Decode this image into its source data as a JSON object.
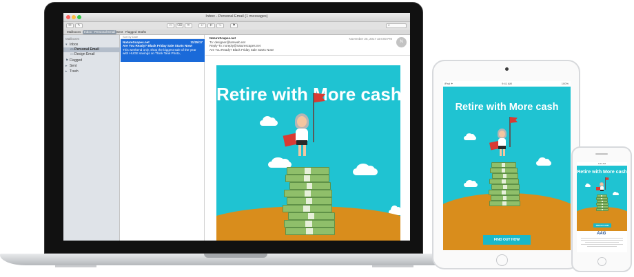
{
  "mail": {
    "window_title": "Inbox - Personal Email (1 messages)",
    "favorites": [
      "Mailboxes",
      "Inbox - Personal Email",
      "Sent",
      "Flagged",
      "Drafts"
    ],
    "sidebar": {
      "heading": "Mailboxes",
      "items": [
        "Inbox",
        "Personal Email",
        "Design Email",
        "Flagged",
        "Sent",
        "Trash"
      ]
    },
    "list": {
      "sort_label": "Sort by Date",
      "message": {
        "sender": "NatureScapes.net",
        "date": "11/25/17",
        "subject": "Are You Ready? Black Friday Sale Starts Now!",
        "preview": "This weekend only, shop the biggest sale of the year with HUGE savings on Think Tank Photo,"
      }
    },
    "reader": {
      "from": "NatureScapes.net",
      "to": "To:  designer@lamweb.net",
      "reply_to": "Reply-To:  noreply@naturescapes.net",
      "subject": "Are You Ready? Black Friday Sale Starts Now!",
      "datetime": "November 25, 2017 at 8:00 PM",
      "avatar_initial": "N"
    }
  },
  "email_art": {
    "headline": "Retire with More cash",
    "cta_label": "FIND OUT HOW",
    "colors": {
      "sky": "#1fc3d2",
      "ground": "#d98d1c",
      "cape": "#d93a33",
      "money": "#8fbf6a"
    }
  },
  "tablet": {
    "status_left": "iPad ✦",
    "status_time": "9:41 AM",
    "status_right": "100%"
  },
  "phone": {
    "status_time": "9:41 AM",
    "logo": "AAG",
    "logo_icon": "brand-logo-icon"
  }
}
